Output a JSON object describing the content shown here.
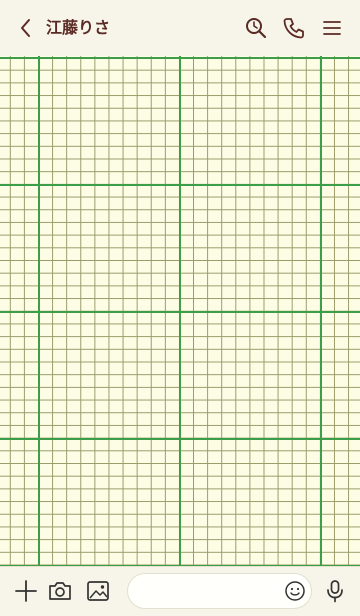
{
  "header": {
    "title": "江藤りさ",
    "icons": [
      "chevron-left-icon",
      "search-icon",
      "phone-icon",
      "menu-icon"
    ]
  },
  "footer": {
    "icons": [
      "plus-icon",
      "camera-icon",
      "image-icon",
      "emoji-icon",
      "microphone-icon"
    ],
    "input_value": ""
  },
  "colors": {
    "header_bg": "#f7f5e9",
    "title_text": "#5a2a24",
    "grid_major": "#3d9e4a",
    "grid_minor": "#9a9a6a",
    "paper": "#fdfde6"
  }
}
